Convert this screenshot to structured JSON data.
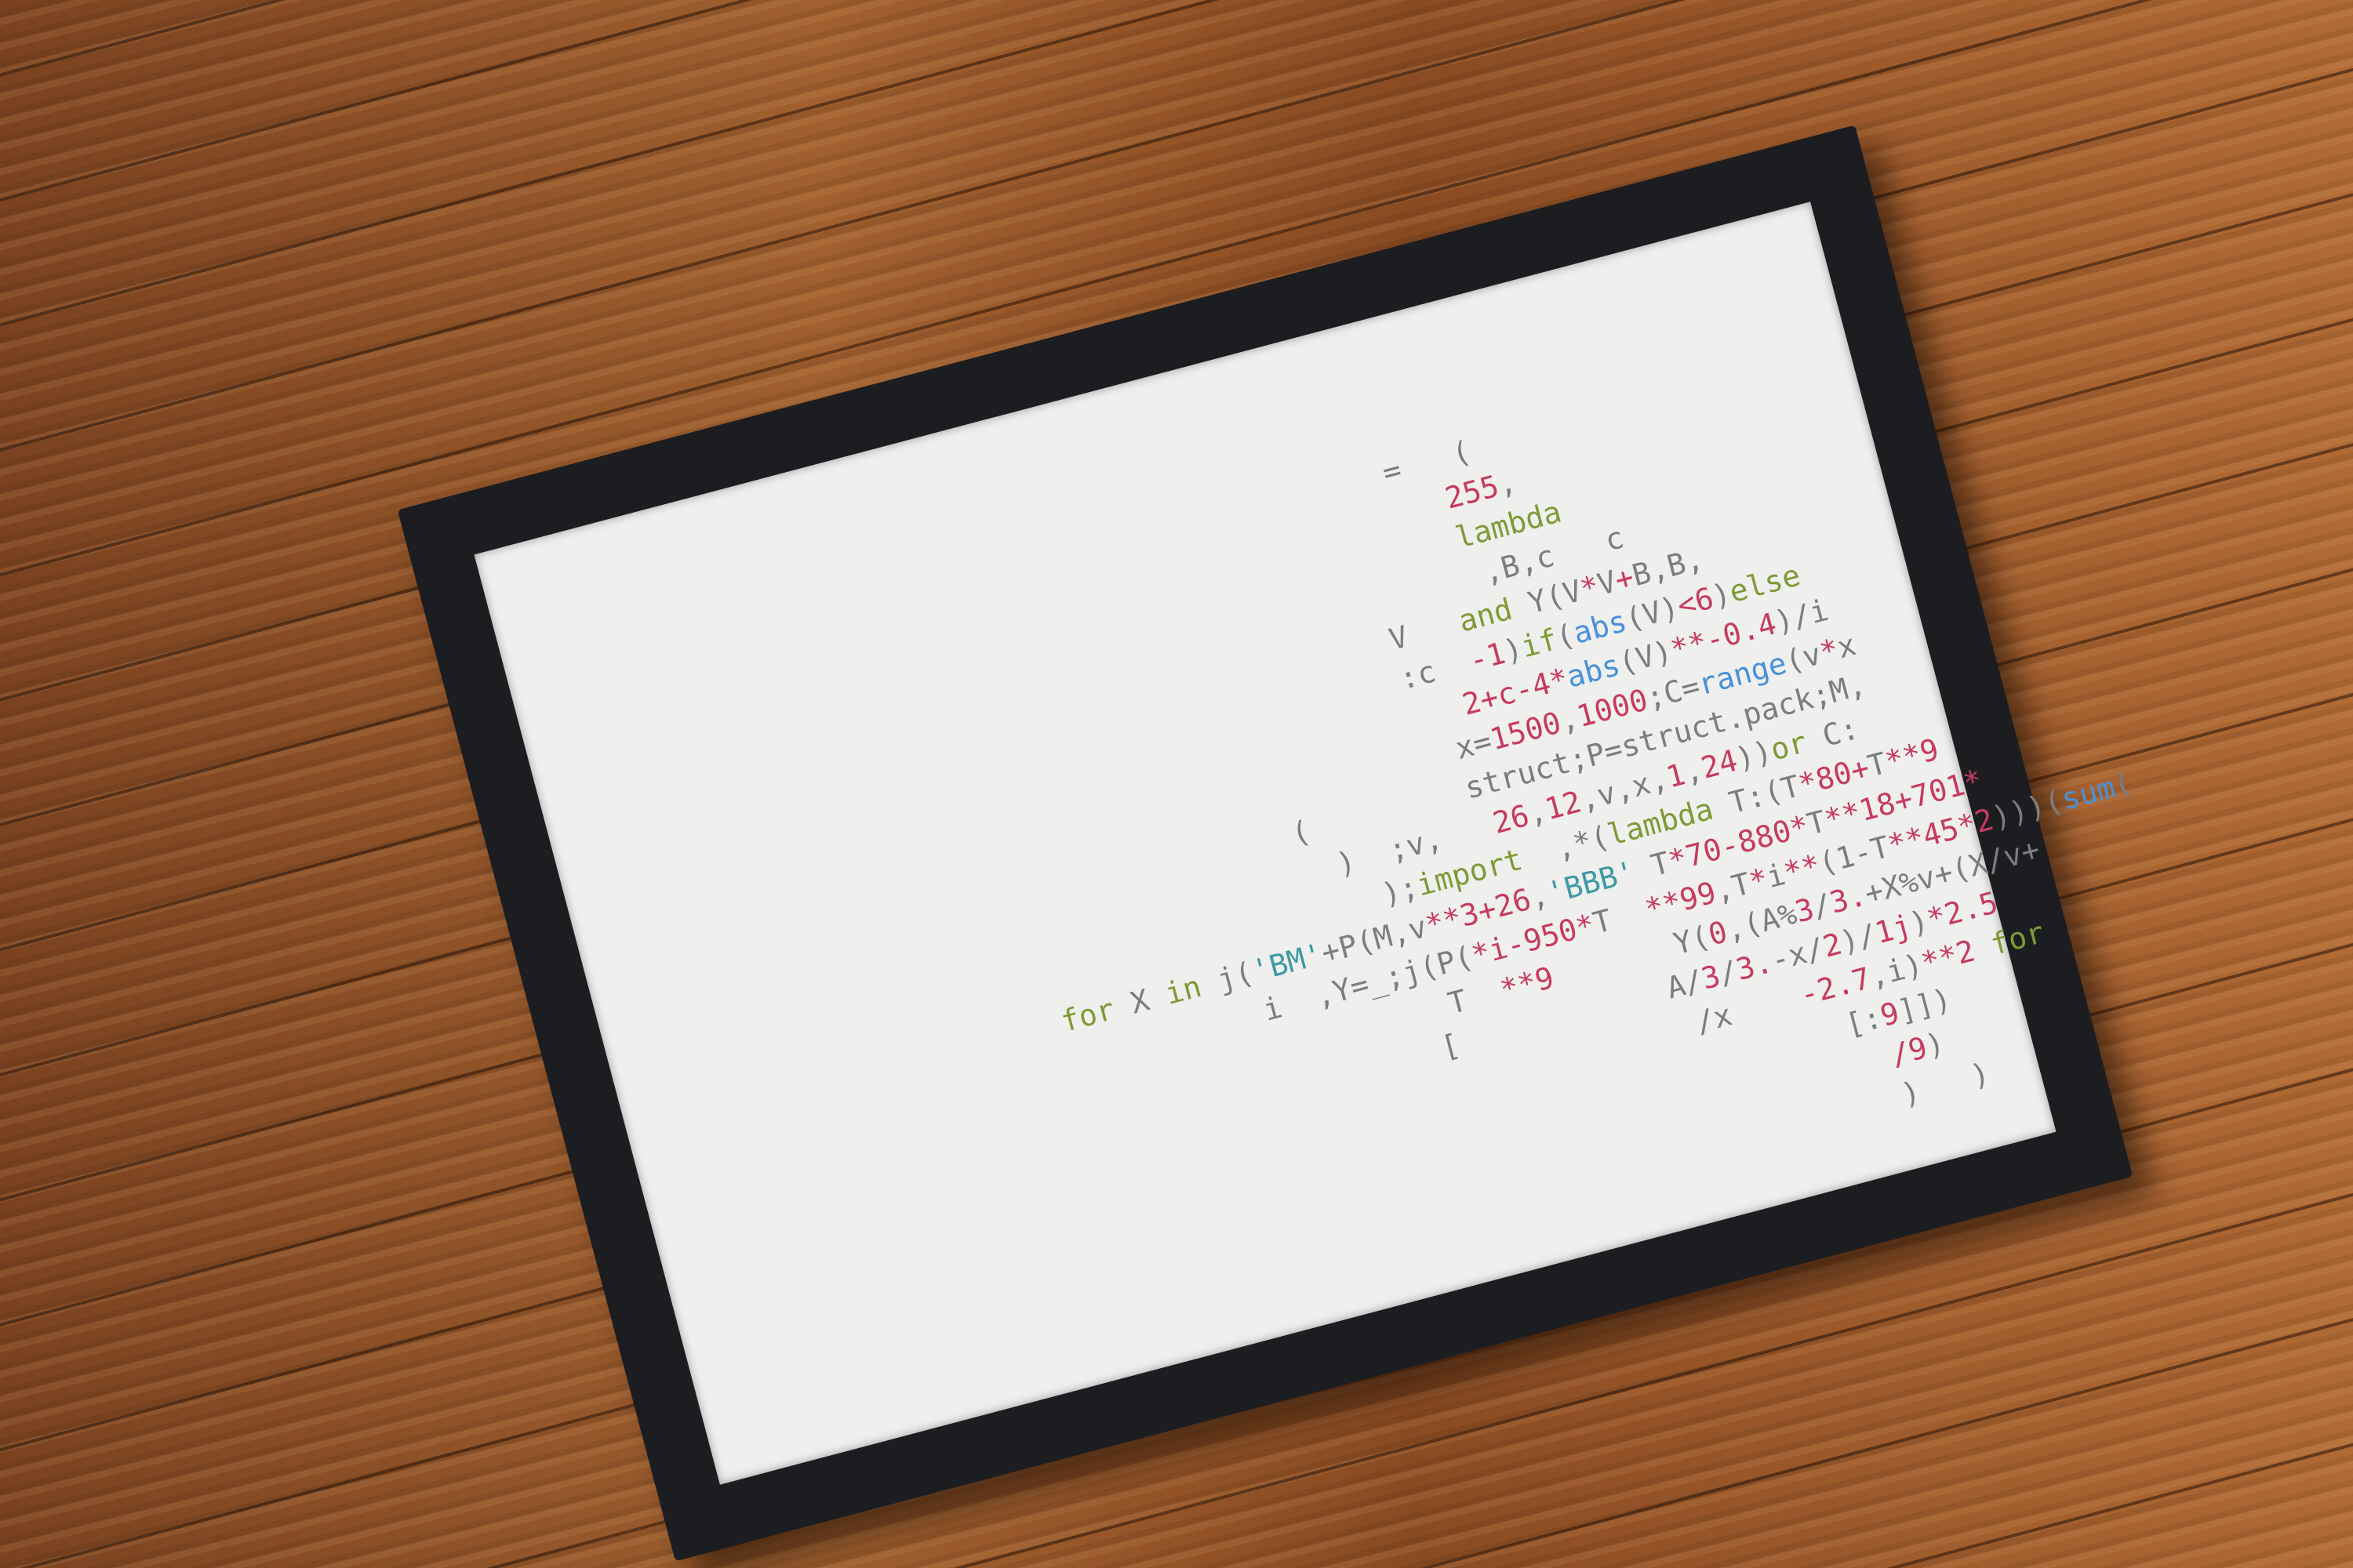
{
  "artwork": {
    "description_colors": {
      "frame": "#1c1d20",
      "paper": "#efefee",
      "operator": "#7b7d81",
      "keyword": "#7f9a36",
      "number": "#c73a62",
      "builtin": "#4a90d9",
      "string": "#3e9aa3"
    },
    "lines": [
      {
        "indent": 49,
        "tokens": [
          {
            "t": "=",
            "c": "op"
          },
          {
            "t": "   (",
            "c": "op"
          }
        ]
      },
      {
        "indent": 52,
        "tokens": [
          {
            "t": "255",
            "c": "num"
          },
          {
            "t": ",",
            "c": "op"
          }
        ]
      },
      {
        "indent": 52,
        "tokens": [
          {
            "t": "lambda",
            "c": "kw"
          }
        ]
      },
      {
        "indent": 53,
        "tokens": [
          {
            "t": ",B,c",
            "c": "op"
          },
          {
            "t": "   c",
            "c": "op"
          }
        ]
      },
      {
        "indent": 47,
        "tokens": [
          {
            "t": "V",
            "c": "op"
          },
          {
            "t": "   ",
            "c": "op"
          },
          {
            "t": "and",
            "c": "kw"
          },
          {
            "t": " Y(V",
            "c": "op"
          },
          {
            "t": "*",
            "c": "num"
          },
          {
            "t": "V",
            "c": "op"
          },
          {
            "t": "+",
            "c": "num"
          },
          {
            "t": "B,B,",
            "c": "op"
          }
        ]
      },
      {
        "indent": 47,
        "tokens": [
          {
            "t": ":c",
            "c": "op"
          },
          {
            "t": "  ",
            "c": "op"
          },
          {
            "t": "-1",
            "c": "num"
          },
          {
            "t": ")",
            "c": "op"
          },
          {
            "t": "if",
            "c": "kw"
          },
          {
            "t": "(",
            "c": "op"
          },
          {
            "t": "abs",
            "c": "bi"
          },
          {
            "t": "(V)",
            "c": "op"
          },
          {
            "t": "<6",
            "c": "num"
          },
          {
            "t": ")",
            "c": "op"
          },
          {
            "t": "else",
            "c": "kw"
          }
        ]
      },
      {
        "indent": 50,
        "tokens": [
          {
            "t": "2+c-4",
            "c": "num"
          },
          {
            "t": "*",
            "c": "num"
          },
          {
            "t": "abs",
            "c": "bi"
          },
          {
            "t": "(V)",
            "c": "op"
          },
          {
            "t": "**-0.4",
            "c": "num"
          },
          {
            "t": ")/i",
            "c": "op"
          }
        ]
      },
      {
        "indent": 49,
        "tokens": [
          {
            "t": "x=",
            "c": "op"
          },
          {
            "t": "1500",
            "c": "num"
          },
          {
            "t": ",",
            "c": "op"
          },
          {
            "t": "1000",
            "c": "num"
          },
          {
            "t": ";C=",
            "c": "op"
          },
          {
            "t": "range",
            "c": "bi"
          },
          {
            "t": "(v",
            "c": "op"
          },
          {
            "t": "*",
            "c": "num"
          },
          {
            "t": "x",
            "c": "op"
          }
        ]
      },
      {
        "indent": 39,
        "tokens": [
          {
            "t": "(",
            "c": "op"
          },
          {
            "t": "         ",
            "c": "op"
          },
          {
            "t": "struct",
            "c": "op"
          },
          {
            "t": ";P=struct.pack;M,",
            "c": "op"
          }
        ]
      },
      {
        "indent": 41,
        "tokens": [
          {
            "t": ")  ;v,",
            "c": "op"
          },
          {
            "t": "   ",
            "c": "op"
          },
          {
            "t": "26",
            "c": "num"
          },
          {
            "t": ",",
            "c": "op"
          },
          {
            "t": "12",
            "c": "num"
          },
          {
            "t": ",v,x,",
            "c": "op"
          },
          {
            "t": "1",
            "c": "num"
          },
          {
            "t": ",",
            "c": "op"
          },
          {
            "t": "24",
            "c": "num"
          },
          {
            "t": "))",
            "c": "op"
          },
          {
            "t": "or",
            "c": "kw"
          },
          {
            "t": " C:",
            "c": "op"
          }
        ]
      },
      {
        "indent": 43,
        "tokens": [
          {
            "t": ");",
            "c": "op"
          },
          {
            "t": "import",
            "c": "kw"
          },
          {
            "t": "  ",
            "c": "op"
          },
          {
            "t": ",*(",
            "c": "op"
          },
          {
            "t": "lambda",
            "c": "kw"
          },
          {
            "t": " T:(T",
            "c": "op"
          },
          {
            "t": "*80+",
            "c": "num"
          },
          {
            "t": "T",
            "c": "op"
          },
          {
            "t": "**9",
            "c": "num"
          }
        ]
      },
      {
        "indent": 24,
        "tokens": [
          {
            "t": "for",
            "c": "kw"
          },
          {
            "t": " X ",
            "c": "op"
          },
          {
            "t": "in",
            "c": "kw"
          },
          {
            "t": " j(",
            "c": "op"
          },
          {
            "t": "'BM'",
            "c": "str"
          },
          {
            "t": "+P(M,v",
            "c": "op"
          },
          {
            "t": "**3+26",
            "c": "num"
          },
          {
            "t": ",",
            "c": "op"
          },
          {
            "t": "'BBB'",
            "c": "str"
          },
          {
            "t": " T",
            "c": "op"
          },
          {
            "t": "*70-880*",
            "c": "num"
          },
          {
            "t": "T",
            "c": "op"
          },
          {
            "t": "**18+701*",
            "c": "num"
          }
        ]
      },
      {
        "indent": 35,
        "tokens": [
          {
            "t": "i  ,Y=_;j(P(",
            "c": "op"
          },
          {
            "t": "*i-950*",
            "c": "num"
          },
          {
            "t": "T",
            "c": "op"
          },
          {
            "t": "  ",
            "c": "op"
          },
          {
            "t": "**99",
            "c": "num"
          },
          {
            "t": ",T",
            "c": "op"
          },
          {
            "t": "*",
            "c": "num"
          },
          {
            "t": "i",
            "c": "op"
          },
          {
            "t": "**",
            "c": "num"
          },
          {
            "t": "(1-T",
            "c": "op"
          },
          {
            "t": "**45*2",
            "c": "num"
          },
          {
            "t": ")))(",
            "c": "op"
          },
          {
            "t": "sum",
            "c": "bi"
          },
          {
            "t": "(",
            "c": "op"
          }
        ]
      },
      {
        "indent": 45,
        "tokens": [
          {
            "t": "T",
            "c": "op"
          },
          {
            "t": "  ",
            "c": "op"
          },
          {
            "t": "**9",
            "c": "num"
          },
          {
            "t": "       ",
            "c": "op"
          },
          {
            "t": "Y(",
            "c": "op"
          },
          {
            "t": "0",
            "c": "num"
          },
          {
            "t": ",(A%",
            "c": "op"
          },
          {
            "t": "3",
            "c": "num"
          },
          {
            "t": "/",
            "c": "op"
          },
          {
            "t": "3.",
            "c": "num"
          },
          {
            "t": "+X%v+(X/v+",
            "c": "op"
          }
        ]
      },
      {
        "indent": 44,
        "tokens": [
          {
            "t": "[",
            "c": "op"
          },
          {
            "t": "            ",
            "c": "op"
          },
          {
            "t": "A/",
            "c": "op"
          },
          {
            "t": "3",
            "c": "num"
          },
          {
            "t": "/",
            "c": "op"
          },
          {
            "t": "3.",
            "c": "num"
          },
          {
            "t": "-x/",
            "c": "op"
          },
          {
            "t": "2",
            "c": "num"
          },
          {
            "t": ")/",
            "c": "op"
          },
          {
            "t": "1j",
            "c": "num"
          },
          {
            "t": ")",
            "c": "op"
          },
          {
            "t": "*2.5",
            "c": "num"
          }
        ]
      },
      {
        "indent": 58,
        "tokens": [
          {
            "t": "/x",
            "c": "op"
          },
          {
            "t": "    ",
            "c": "op"
          },
          {
            "t": "-2.7",
            "c": "num"
          },
          {
            "t": ",i)",
            "c": "op"
          },
          {
            "t": "**2",
            "c": "num"
          },
          {
            "t": " ",
            "c": "op"
          },
          {
            "t": "for",
            "c": "kw"
          }
        ]
      },
      {
        "indent": 66,
        "tokens": [
          {
            "t": "[:",
            "c": "op"
          },
          {
            "t": "9",
            "c": "num"
          },
          {
            "t": "]])",
            "c": "op"
          }
        ]
      },
      {
        "indent": 68,
        "tokens": [
          {
            "t": "/9",
            "c": "num"
          },
          {
            "t": ")",
            "c": "op"
          }
        ]
      },
      {
        "indent": 68,
        "tokens": [
          {
            "t": ")   )",
            "c": "op"
          }
        ]
      }
    ]
  }
}
